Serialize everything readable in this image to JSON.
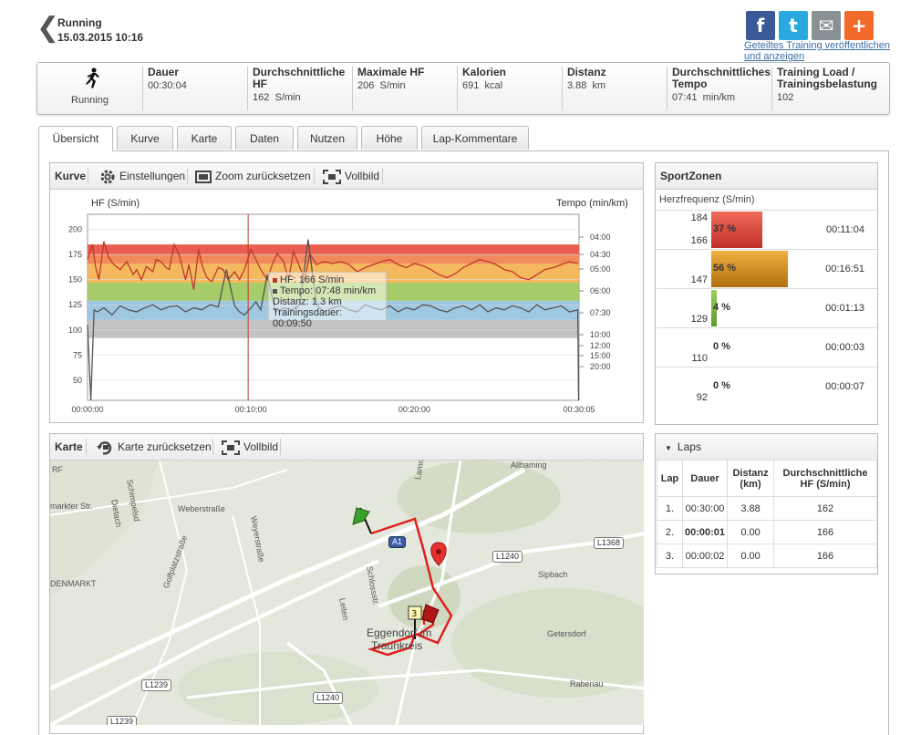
{
  "header": {
    "activity": "Running",
    "datetime": "15.03.2015 10:16",
    "share_text": "Geteiltes Training veröffentlichen und anzeigen"
  },
  "social": [
    {
      "name": "facebook-icon",
      "glyph": "f",
      "color": "#3b5998"
    },
    {
      "name": "twitter-icon",
      "glyph": "t",
      "color": "#2aa9e0"
    },
    {
      "name": "email-icon",
      "glyph": "✉",
      "color": "#8a9196"
    },
    {
      "name": "share-plus-icon",
      "glyph": "+",
      "color": "#f26a2a"
    }
  ],
  "stats": {
    "sport_label": "Running",
    "items": [
      {
        "label": "Dauer",
        "value": "00:30:04",
        "unit": ""
      },
      {
        "label": "Durchschnittliche HF",
        "value": "162",
        "unit": "S/min"
      },
      {
        "label": "Maximale HF",
        "value": "206",
        "unit": "S/min"
      },
      {
        "label": "Kalorien",
        "value": "691",
        "unit": "kcal"
      },
      {
        "label": "Distanz",
        "value": "3.88",
        "unit": "km"
      },
      {
        "label": "Durchschnittliches Tempo",
        "value": "07:41",
        "unit": "min/km"
      },
      {
        "label": "Training Load / Trainingsbelastung",
        "value": "102",
        "unit": ""
      }
    ]
  },
  "tabs": [
    "Übersicht",
    "Kurve",
    "Karte",
    "Daten",
    "Nutzen",
    "Höhe",
    "Lap-Kommentare"
  ],
  "active_tab": 0,
  "curve_panel": {
    "title": "Kurve",
    "settings": "Einstellungen",
    "zoom_reset": "Zoom zurücksetzen",
    "fullscreen": "Vollbild"
  },
  "chart_data": {
    "type": "line",
    "ylabel_left": "HF (S/min)",
    "ylabel_right": "Tempo (min/km)",
    "y_left_ticks": [
      200,
      175,
      150,
      125,
      100,
      75,
      50
    ],
    "y_right_ticks": [
      "04:00",
      "04:30",
      "05:00",
      "06:00",
      "07:30",
      "10:00",
      "12:00",
      "15:00",
      "20:00"
    ],
    "x_ticks": [
      "00:00:00",
      "00:10:00",
      "00:20:00",
      "00:30:05"
    ],
    "zones": [
      {
        "from": 175,
        "to": 185,
        "color": "#e74c3c"
      },
      {
        "from": 166,
        "to": 175,
        "color": "#f07d4a"
      },
      {
        "from": 147,
        "to": 166,
        "color": "#f3b04d"
      },
      {
        "from": 129,
        "to": 147,
        "color": "#9cc85a"
      },
      {
        "from": 110,
        "to": 129,
        "color": "#93c1de"
      },
      {
        "from": 92,
        "to": 110,
        "color": "#bdbdbd"
      }
    ],
    "series": [
      {
        "name": "HF",
        "color": "#c0392b",
        "minutes": [
          0,
          0.3,
          0.5,
          0.7,
          1,
          1.3,
          1.6,
          2,
          2.4,
          2.8,
          3,
          3.3,
          3.6,
          4,
          4.2,
          4.5,
          4.8,
          5,
          5.3,
          5.6,
          6,
          6.2,
          6.5,
          6.8,
          7,
          7.3,
          7.6,
          8,
          8.3,
          8.6,
          9,
          9.3,
          9.6,
          10,
          10.3,
          10.6,
          11,
          11.3,
          11.6,
          12,
          12.3,
          12.6,
          13,
          13.3,
          13.6,
          14,
          14.5,
          15,
          15.5,
          16,
          16.5,
          17,
          17.5,
          18,
          18.5,
          19,
          19.5,
          20,
          20.5,
          21,
          21.5,
          22,
          22.5,
          23,
          23.5,
          24,
          24.5,
          25,
          25.5,
          26,
          26.5,
          27,
          27.5,
          28,
          28.5,
          29,
          29.5,
          30
        ],
        "values": [
          170,
          185,
          162,
          150,
          188,
          172,
          165,
          160,
          168,
          155,
          160,
          150,
          163,
          158,
          170,
          168,
          162,
          160,
          185,
          175,
          150,
          165,
          140,
          180,
          165,
          152,
          148,
          162,
          160,
          150,
          158,
          150,
          160,
          180,
          170,
          160,
          150,
          165,
          176,
          168,
          150,
          178,
          162,
          150,
          176,
          165,
          168,
          166,
          168,
          165,
          158,
          162,
          165,
          168,
          170,
          165,
          162,
          166,
          164,
          160,
          155,
          152,
          156,
          162,
          166,
          170,
          168,
          165,
          160,
          158,
          152,
          150,
          155,
          160,
          162,
          165,
          168,
          166
        ]
      },
      {
        "name": "Tempo",
        "color": "#555555",
        "minutes": [
          0,
          0.2,
          0.4,
          0.6,
          1,
          1.5,
          2,
          2.5,
          3,
          3.5,
          4,
          4.5,
          5,
          5.5,
          6,
          6.5,
          7,
          7.5,
          8,
          8.5,
          9,
          9.3,
          9.6,
          10,
          10.3,
          10.6,
          11,
          11.5,
          12,
          12.5,
          13,
          13.5,
          14,
          14.5,
          15,
          15.5,
          16,
          16.5,
          17,
          17.5,
          18,
          18.5,
          19,
          19.5,
          20,
          20.5,
          21,
          21.5,
          22,
          22.5,
          23,
          23.5,
          24,
          24.5,
          25,
          25.5,
          26,
          26.5,
          27,
          27.5,
          28,
          28.5,
          29,
          29.5,
          30,
          30.05
        ],
        "values": [
          105,
          0,
          120,
          118,
          122,
          115,
          124,
          120,
          118,
          122,
          125,
          120,
          123,
          124,
          118,
          122,
          120,
          125,
          123,
          160,
          124,
          118,
          115,
          122,
          128,
          120,
          155,
          118,
          122,
          120,
          125,
          190,
          125,
          118,
          122,
          124,
          120,
          118,
          125,
          122,
          120,
          124,
          118,
          122,
          120,
          125,
          124,
          120,
          118,
          122,
          124,
          120,
          125,
          118,
          122,
          120,
          124,
          122,
          118,
          125,
          120,
          122,
          124,
          118,
          120,
          0
        ]
      }
    ],
    "tooltip": {
      "hf": "HF: 166 S/min",
      "tempo": "Tempo: 07:48 min/km",
      "distanz": "Distanz: 1.3 km",
      "dauer": "Trainingsdauer: 00:09:50"
    }
  },
  "sportzones": {
    "title": "SportZonen",
    "subtitle": "Herzfrequenz (S/min)",
    "rows": [
      {
        "hi": "184",
        "lo": "166",
        "pct": "37 %",
        "time": "00:11:04",
        "fraction": 0.37,
        "color_top": "#f06a5a",
        "color_bottom": "#c0302a"
      },
      {
        "hi": "",
        "lo": "147",
        "pct": "56 %",
        "time": "00:16:51",
        "fraction": 0.56,
        "color_top": "#f0b040",
        "color_bottom": "#b07010"
      },
      {
        "hi": "",
        "lo": "129",
        "pct": "4 %",
        "time": "00:01:13",
        "fraction": 0.04,
        "color_top": "#9ccf5a",
        "color_bottom": "#5a9a2a"
      },
      {
        "hi": "",
        "lo": "110",
        "pct": "0 %",
        "time": "00:00:03",
        "fraction": 0,
        "color_top": "#93c1de",
        "color_bottom": "#5a90b0"
      },
      {
        "hi": "",
        "lo": "92",
        "pct": "0 %",
        "time": "00:00:07",
        "fraction": 0,
        "color_top": "#bbbbbb",
        "color_bottom": "#888888"
      }
    ]
  },
  "map_panel": {
    "title": "Karte",
    "reset": "Karte zurücksetzen",
    "fullscreen": "Vollbild",
    "labels": [
      "Weberstraße",
      "Schimpelsd",
      "Dietach",
      "Weyerstraße",
      "Golfplatzstraße",
      "Schlossstr.",
      "Leiten",
      "Eggendorf im",
      "Traunkreis",
      "Sipbach",
      "Getersdorf",
      "Rabenau",
      "Lammy",
      "Allhaming",
      "DENMARKT",
      "markter Str.",
      "RF"
    ],
    "roads": [
      "A1",
      "L1240",
      "L1368",
      "L1240",
      "L1239",
      "L1239"
    ],
    "lap_marker": "3"
  },
  "laps": {
    "title": "Laps",
    "headers": [
      "Lap",
      "Dauer",
      "Distanz (km)",
      "Durchschnittliche HF (S/min)"
    ],
    "rows": [
      {
        "lap": "1.",
        "dauer": "00:30:00",
        "distanz": "3.88",
        "hf": "162"
      },
      {
        "lap": "2.",
        "dauer": "00:00:01",
        "distanz": "0.00",
        "hf": "166"
      },
      {
        "lap": "3.",
        "dauer": "00:00:02",
        "distanz": "0.00",
        "hf": "166"
      }
    ]
  }
}
